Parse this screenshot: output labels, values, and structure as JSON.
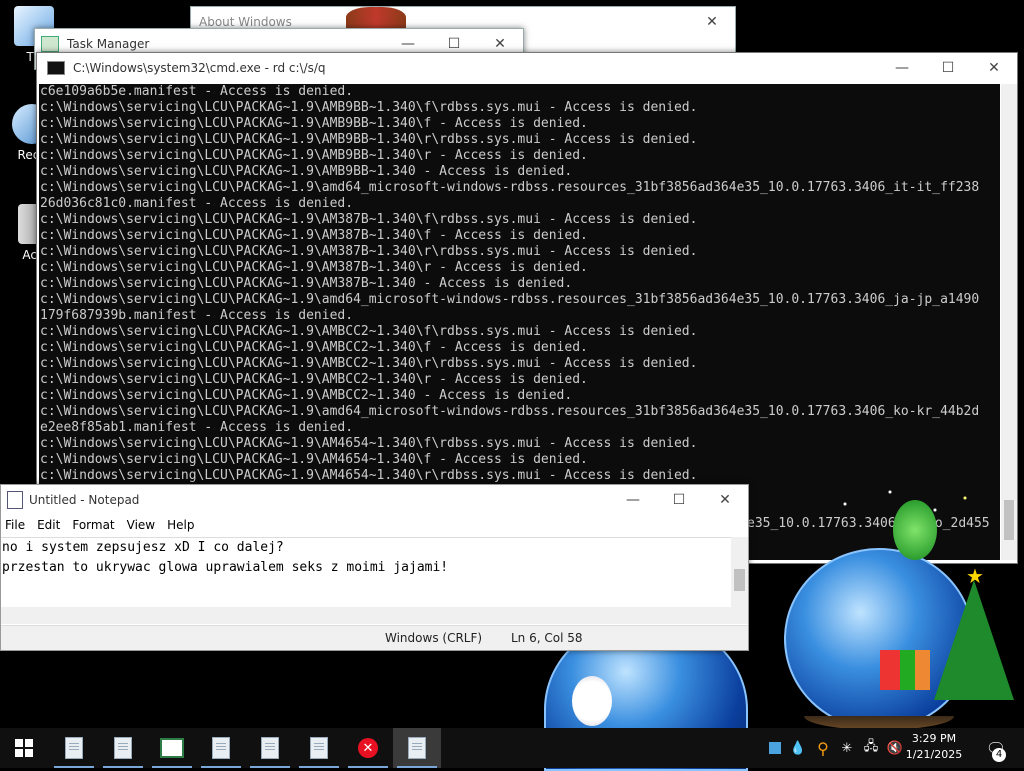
{
  "desktop": {
    "icons": [
      {
        "label": "Th",
        "icon": "computer-icon"
      },
      {
        "label": "Recy",
        "icon": "recycle-bin-icon"
      },
      {
        "label": "Act",
        "icon": "file-icon"
      }
    ]
  },
  "windows": {
    "about": {
      "title": "About Windows"
    },
    "taskmgr": {
      "title": "Task Manager"
    },
    "cmd": {
      "title": "C:\\Windows\\system32\\cmd.exe - rd  c:\\/s/q",
      "lines": [
        "c6e109a6b5e.manifest - Access is denied.",
        "c:\\Windows\\servicing\\LCU\\PACKAG~1.9\\AMB9BB~1.340\\f\\rdbss.sys.mui - Access is denied.",
        "c:\\Windows\\servicing\\LCU\\PACKAG~1.9\\AMB9BB~1.340\\f - Access is denied.",
        "c:\\Windows\\servicing\\LCU\\PACKAG~1.9\\AMB9BB~1.340\\r\\rdbss.sys.mui - Access is denied.",
        "c:\\Windows\\servicing\\LCU\\PACKAG~1.9\\AMB9BB~1.340\\r - Access is denied.",
        "c:\\Windows\\servicing\\LCU\\PACKAG~1.9\\AMB9BB~1.340 - Access is denied.",
        "c:\\Windows\\servicing\\LCU\\PACKAG~1.9\\amd64_microsoft-windows-rdbss.resources_31bf3856ad364e35_10.0.17763.3406_it-it_ff238",
        "26d036c81c0.manifest - Access is denied.",
        "c:\\Windows\\servicing\\LCU\\PACKAG~1.9\\AM387B~1.340\\f\\rdbss.sys.mui - Access is denied.",
        "c:\\Windows\\servicing\\LCU\\PACKAG~1.9\\AM387B~1.340\\f - Access is denied.",
        "c:\\Windows\\servicing\\LCU\\PACKAG~1.9\\AM387B~1.340\\r\\rdbss.sys.mui - Access is denied.",
        "c:\\Windows\\servicing\\LCU\\PACKAG~1.9\\AM387B~1.340\\r - Access is denied.",
        "c:\\Windows\\servicing\\LCU\\PACKAG~1.9\\AM387B~1.340 - Access is denied.",
        "c:\\Windows\\servicing\\LCU\\PACKAG~1.9\\amd64_microsoft-windows-rdbss.resources_31bf3856ad364e35_10.0.17763.3406_ja-jp_a1490",
        "179f687939b.manifest - Access is denied.",
        "c:\\Windows\\servicing\\LCU\\PACKAG~1.9\\AMBCC2~1.340\\f\\rdbss.sys.mui - Access is denied.",
        "c:\\Windows\\servicing\\LCU\\PACKAG~1.9\\AMBCC2~1.340\\f - Access is denied.",
        "c:\\Windows\\servicing\\LCU\\PACKAG~1.9\\AMBCC2~1.340\\r\\rdbss.sys.mui - Access is denied.",
        "c:\\Windows\\servicing\\LCU\\PACKAG~1.9\\AMBCC2~1.340\\r - Access is denied.",
        "c:\\Windows\\servicing\\LCU\\PACKAG~1.9\\AMBCC2~1.340 - Access is denied.",
        "c:\\Windows\\servicing\\LCU\\PACKAG~1.9\\amd64_microsoft-windows-rdbss.resources_31bf3856ad364e35_10.0.17763.3406_ko-kr_44b2d",
        "e2ee8f85ab1.manifest - Access is denied.",
        "c:\\Windows\\servicing\\LCU\\PACKAG~1.9\\AM4654~1.340\\f\\rdbss.sys.mui - Access is denied.",
        "c:\\Windows\\servicing\\LCU\\PACKAG~1.9\\AM4654~1.340\\f - Access is denied.",
        "c:\\Windows\\servicing\\LCU\\PACKAG~1.9\\AM4654~1.340\\r\\rdbss.sys.mui - Access is denied."
      ],
      "hidden_line_fragment": "e35_10.0.17763.3406_no-no_2d455"
    },
    "notepad": {
      "title": "Untitled - Notepad",
      "menu": [
        "File",
        "Edit",
        "Format",
        "View",
        "Help"
      ],
      "text": "no i system zepsujesz xD I co dalej?\nprzestan to ukrywac glowa uprawialem seks z moimi jajami!",
      "status": {
        "encoding": "Windows (CRLF)",
        "position": "Ln 6, Col 58"
      }
    }
  },
  "taskbar": {
    "apps": [
      {
        "name": "taskbar-doc-1",
        "icon": "document-icon"
      },
      {
        "name": "taskbar-doc-2",
        "icon": "document-icon"
      },
      {
        "name": "taskbar-app-3",
        "icon": "window-icon"
      },
      {
        "name": "taskbar-doc-4",
        "icon": "document-icon"
      },
      {
        "name": "taskbar-doc-5",
        "icon": "document-icon"
      },
      {
        "name": "taskbar-doc-6",
        "icon": "document-icon"
      },
      {
        "name": "taskbar-error-7",
        "icon": "error-icon"
      },
      {
        "name": "taskbar-notepad-8",
        "icon": "document-icon"
      }
    ],
    "clock": {
      "time": "3:29 PM",
      "date": "1/21/2025"
    },
    "notifications_count": "4",
    "colors": {
      "accent": "#7aa7d8",
      "error": "#e81123"
    }
  }
}
